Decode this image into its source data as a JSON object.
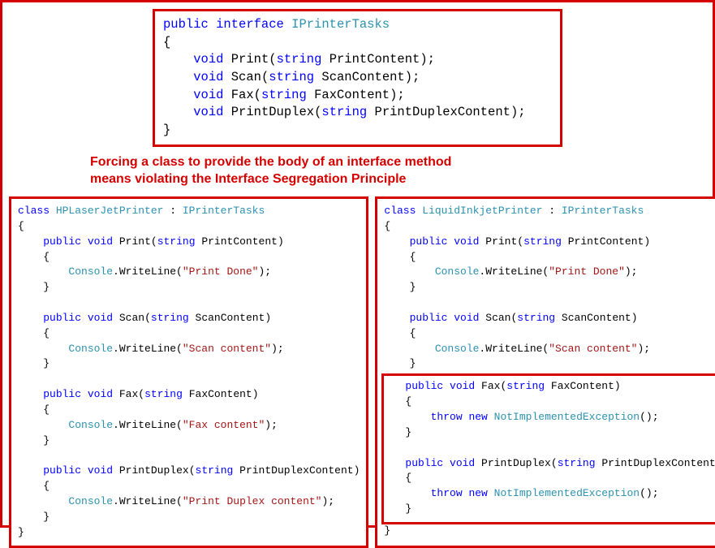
{
  "interface": {
    "decl_kw_public": "public",
    "decl_kw_interface": "interface",
    "name": "IPrinterTasks",
    "brace_open": "{",
    "brace_close": "}",
    "methods": [
      {
        "ret_kw": "void",
        "name": "Print",
        "param_type": "string",
        "param_name": "PrintContent"
      },
      {
        "ret_kw": "void",
        "name": "Scan",
        "param_type": "string",
        "param_name": "ScanContent"
      },
      {
        "ret_kw": "void",
        "name": "Fax",
        "param_type": "string",
        "param_name": "FaxContent"
      },
      {
        "ret_kw": "void",
        "name": "PrintDuplex",
        "param_type": "string",
        "param_name": "PrintDuplexContent"
      }
    ]
  },
  "caption": {
    "line1": "Forcing a class to provide the body of an interface method",
    "line2": "means violating the Interface Segregation Principle"
  },
  "left": {
    "kw_class": "class",
    "class_name": "HPLaserJetPrinter",
    "colon": " : ",
    "iface": "IPrinterTasks",
    "brace_open": "{",
    "brace_close": "}",
    "kw_public": "public",
    "kw_void": "void",
    "kw_string": "string",
    "console": "Console",
    "write": ".WriteLine(",
    "close_stmt": ");",
    "m1_name": "Print",
    "m1_param": "PrintContent",
    "m1_str": "\"Print Done\"",
    "m2_name": "Scan",
    "m2_param": "ScanContent",
    "m2_str": "\"Scan content\"",
    "m3_name": "Fax",
    "m3_param": "FaxContent",
    "m3_str": "\"Fax content\"",
    "m4_name": "PrintDuplex",
    "m4_param": "PrintDuplexContent",
    "m4_str": "\"Print Duplex content\""
  },
  "right": {
    "kw_class": "class",
    "class_name": "LiquidInkjetPrinter",
    "colon": " : ",
    "iface": "IPrinterTasks",
    "brace_open": "{",
    "brace_close": "}",
    "kw_public": "public",
    "kw_void": "void",
    "kw_string": "string",
    "console": "Console",
    "write": ".WriteLine(",
    "close_stmt": ");",
    "kw_throw": "throw",
    "kw_new": "new",
    "exc": "NotImplementedException",
    "exc_close": "();",
    "m1_name": "Print",
    "m1_param": "PrintContent",
    "m1_str": "\"Print Done\"",
    "m2_name": "Scan",
    "m2_param": "ScanContent",
    "m2_str": "\"Scan content\"",
    "m3_name": "Fax",
    "m3_param": "FaxContent",
    "m4_name": "PrintDuplex",
    "m4_param": "PrintDuplexContent"
  }
}
